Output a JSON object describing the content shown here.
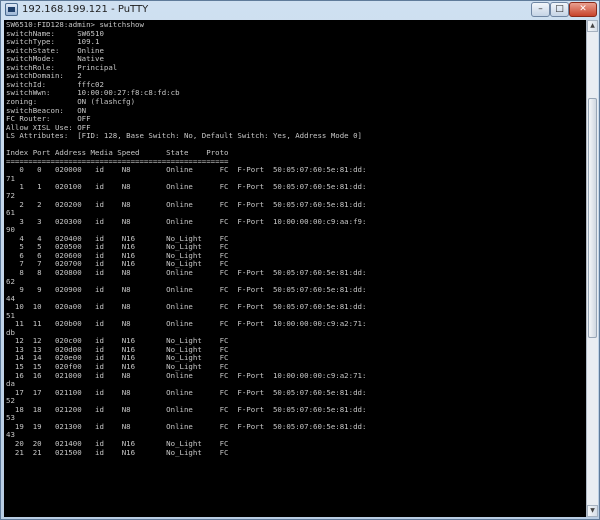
{
  "window": {
    "title": "192.168.199.121 - PuTTY",
    "controls": {
      "minimize": "–",
      "maximize": "□",
      "close": "✕"
    }
  },
  "colors": {
    "terminal_bg": "#000000",
    "terminal_fg": "#c7c7c7"
  },
  "icons": {
    "app": "putty-icon",
    "scroll_up": "arrow-up-icon",
    "scroll_down": "arrow-down-icon"
  },
  "terminal_lines": [
    "SW6510:FID128:admin> switchshow",
    "switchName:     SW6510",
    "switchType:     109.1",
    "switchState:    Online",
    "switchMode:     Native",
    "switchRole:     Principal",
    "switchDomain:   2",
    "switchId:       fffc02",
    "switchWwn:      10:00:00:27:f8:c8:fd:cb",
    "zoning:         ON (flashcfg)",
    "switchBeacon:   ON",
    "FC Router:      OFF",
    "Allow XISL Use: OFF",
    "LS Attributes:  [FID: 128, Base Switch: No, Default Switch: Yes, Address Mode 0]",
    "",
    "Index Port Address Media Speed      State    Proto",
    "==================================================",
    "   0   0   020000   id    N8        Online      FC  F-Port  50:05:07:60:5e:81:dd:",
    "71",
    "   1   1   020100   id    N8        Online      FC  F-Port  50:05:07:60:5e:81:dd:",
    "72",
    "   2   2   020200   id    N8        Online      FC  F-Port  50:05:07:60:5e:81:dd:",
    "61",
    "   3   3   020300   id    N8        Online      FC  F-Port  10:00:00:00:c9:aa:f9:",
    "90",
    "   4   4   020400   id    N16       No_Light    FC",
    "   5   5   020500   id    N16       No_Light    FC",
    "   6   6   020600   id    N16       No_Light    FC",
    "   7   7   020700   id    N16       No_Light    FC",
    "   8   8   020800   id    N8        Online      FC  F-Port  50:05:07:60:5e:81:dd:",
    "62",
    "   9   9   020900   id    N8        Online      FC  F-Port  50:05:07:60:5e:81:dd:",
    "44",
    "  10  10   020a00   id    N8        Online      FC  F-Port  50:05:07:60:5e:81:dd:",
    "51",
    "  11  11   020b00   id    N8        Online      FC  F-Port  10:00:00:00:c9:a2:71:",
    "db",
    "  12  12   020c00   id    N16       No_Light    FC",
    "  13  13   020d00   id    N16       No_Light    FC",
    "  14  14   020e00   id    N16       No_Light    FC",
    "  15  15   020f00   id    N16       No_Light    FC",
    "  16  16   021000   id    N8        Online      FC  F-Port  10:00:00:00:c9:a2:71:",
    "da",
    "  17  17   021100   id    N8        Online      FC  F-Port  50:05:07:60:5e:81:dd:",
    "52",
    "  18  18   021200   id    N8        Online      FC  F-Port  50:05:07:60:5e:81:dd:",
    "53",
    "  19  19   021300   id    N8        Online      FC  F-Port  50:05:07:60:5e:81:dd:",
    "43",
    "  20  20   021400   id    N16       No_Light    FC",
    "  21  21   021500   id    N16       No_Light    FC"
  ]
}
